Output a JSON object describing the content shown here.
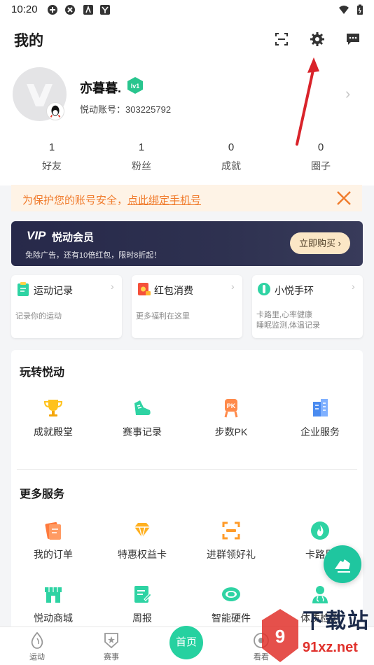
{
  "status_bar": {
    "time": "10:20"
  },
  "header": {
    "title": "我的"
  },
  "profile": {
    "name": "亦暮暮.",
    "level": "lv1",
    "account_label": "悦动账号：303225792",
    "stats": [
      {
        "value": "1",
        "label": "好友"
      },
      {
        "value": "1",
        "label": "粉丝"
      },
      {
        "value": "0",
        "label": "成就"
      },
      {
        "value": "0",
        "label": "圈子"
      }
    ]
  },
  "warning": {
    "text_before": "为保护您的账号安全，",
    "link": "点此绑定手机号"
  },
  "vip": {
    "badge": "VIP",
    "title": "悦动会员",
    "subtitle": "免除广告，还有10倍红包，限时8折起！",
    "button": "立即购买 ›"
  },
  "cards": [
    {
      "title": "运动记录",
      "desc": "记录你的运动"
    },
    {
      "title": "红包消费",
      "desc": "更多福利在这里"
    },
    {
      "title": "小悦手环",
      "desc": "卡路里,心率健康\n睡眠监测,体温记录"
    }
  ],
  "sections": {
    "play": {
      "title": "玩转悦动",
      "items": [
        {
          "label": "成就殿堂",
          "icon": "trophy-icon"
        },
        {
          "label": "赛事记录",
          "icon": "shoe-icon"
        },
        {
          "label": "步数PK",
          "icon": "pk-icon"
        },
        {
          "label": "企业服务",
          "icon": "building-icon"
        }
      ]
    },
    "more": {
      "title": "更多服务",
      "items": [
        {
          "label": "我的订单",
          "icon": "order-icon"
        },
        {
          "label": "特惠权益卡",
          "icon": "diamond-icon"
        },
        {
          "label": "进群领好礼",
          "icon": "scan-group-icon"
        },
        {
          "label": "卡路里",
          "icon": "flame-icon"
        },
        {
          "label": "悦动商城",
          "icon": "store-icon"
        },
        {
          "label": "周报",
          "icon": "report-icon"
        },
        {
          "label": "智能硬件",
          "icon": "band-icon"
        },
        {
          "label": "体质检测",
          "icon": "doctor-icon"
        }
      ]
    }
  },
  "nav": {
    "items": [
      {
        "label": "运动"
      },
      {
        "label": "赛事"
      },
      {
        "label": "首页"
      },
      {
        "label": "看看"
      }
    ]
  },
  "watermark": {
    "title": "下载站",
    "url": "91xz.net"
  },
  "colors": {
    "accent": "#1fc69f",
    "warning": "#f07a2a",
    "vip_bg": "#2a2c4c",
    "vip_btn": "#fbe7c6"
  }
}
